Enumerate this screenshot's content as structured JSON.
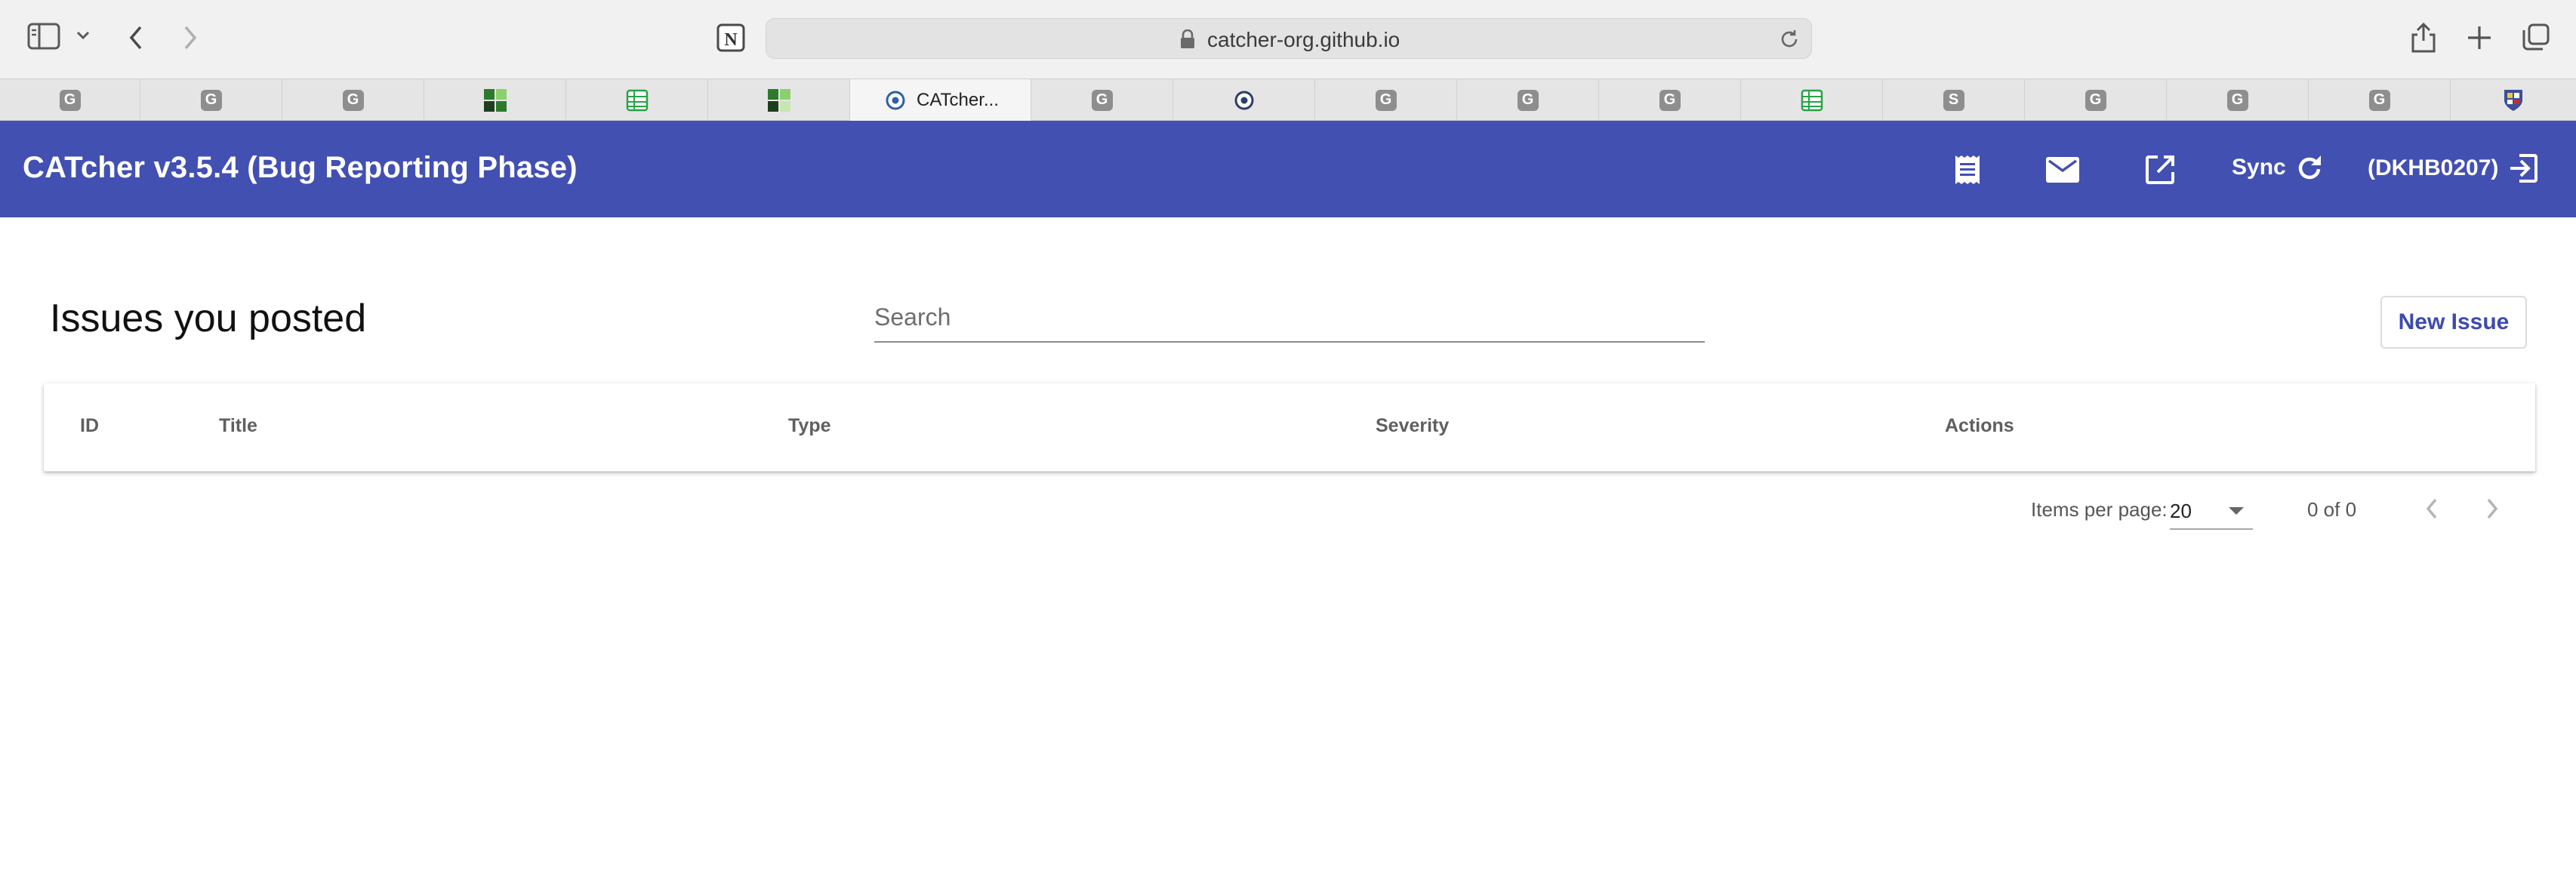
{
  "browser": {
    "url": "catcher-org.github.io",
    "tabs": [
      {
        "icon": "G"
      },
      {
        "icon": "G"
      },
      {
        "icon": "G"
      },
      {
        "icon": "squares-favicon"
      },
      {
        "icon": "sheets-favicon"
      },
      {
        "icon": "squares-favicon"
      },
      {
        "icon": "catcher-favicon",
        "label": "CATcher..."
      },
      {
        "icon": "G"
      },
      {
        "icon": "catcher-favicon"
      },
      {
        "icon": "G"
      },
      {
        "icon": "G"
      },
      {
        "icon": "G"
      },
      {
        "icon": "sheets-favicon"
      },
      {
        "icon": "S"
      },
      {
        "icon": "G"
      },
      {
        "icon": "G"
      },
      {
        "icon": "G"
      },
      {
        "icon": "shield-favicon"
      }
    ]
  },
  "app": {
    "title": "CATcher v3.5.4  (Bug Reporting Phase)",
    "sync_label": "Sync",
    "user_label": "(DKHB0207)",
    "accent": "#4250b2"
  },
  "main": {
    "page_title": "Issues you posted",
    "search_placeholder": "Search",
    "new_issue_label": "New Issue",
    "table": {
      "columns": [
        "ID",
        "Title",
        "Type",
        "Severity",
        "Actions"
      ],
      "rows": []
    },
    "paginator": {
      "items_per_page_label": "Items per page:",
      "items_per_page_value": "20",
      "range_label": "0 of 0"
    }
  }
}
